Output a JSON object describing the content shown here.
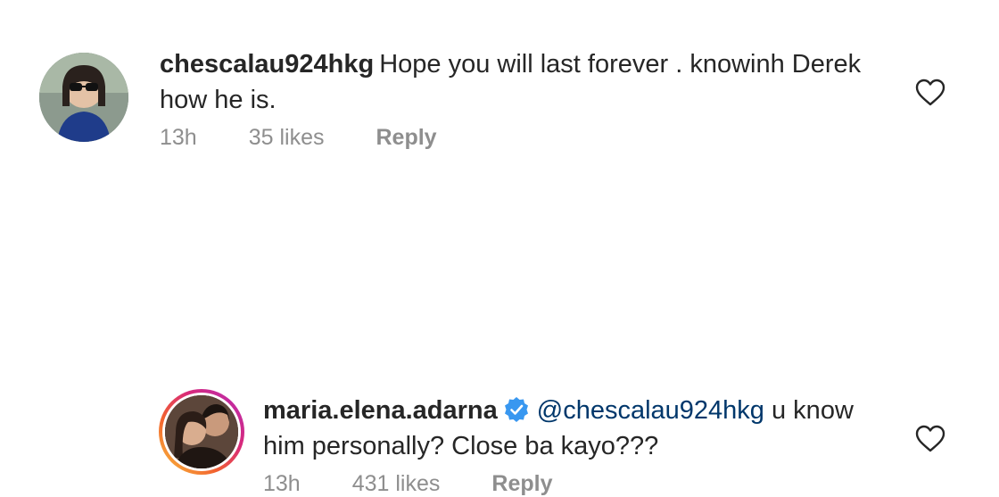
{
  "comments": [
    {
      "username": "chescalau924hkg",
      "text": "Hope you will last forever . knowinh  Derek how he is.",
      "time": "13h",
      "likes": "35 likes",
      "reply_label": "Reply"
    },
    {
      "username": "maria.elena.adarna",
      "mention": "@chescalau924hkg",
      "text": "u know him personally? Close ba kayo???",
      "time": "13h",
      "likes": "431 likes",
      "reply_label": "Reply"
    }
  ],
  "colors": {
    "verified": "#3897f0",
    "mention": "#00376b",
    "meta": "#8e8e8e",
    "text": "#262626"
  },
  "icons": [
    "heart-icon",
    "verified-badge-icon"
  ]
}
